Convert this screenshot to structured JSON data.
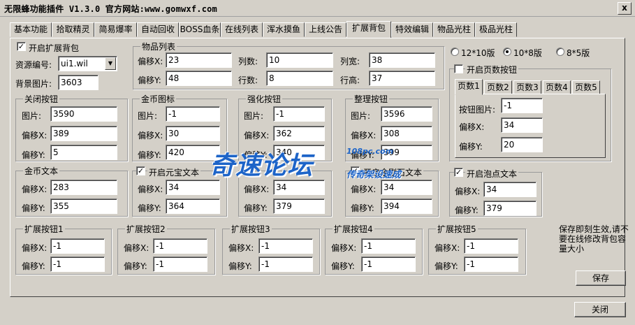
{
  "window": {
    "title": "无限蜂功能插件 V1.3.0  官方网站:www.gomwxf.com",
    "close": "x"
  },
  "tabs": [
    "基本功能",
    "拾取精灵",
    "简易爆率",
    "自动回收",
    "BOSS血条",
    "在线列表",
    "浑水摸鱼",
    "上线公告",
    "扩展背包",
    "特效编辑",
    "物品光柱",
    "极品光柱"
  ],
  "active_tab": "扩展背包",
  "left": {
    "enable_label": "开启扩展背包",
    "enable_checked": true,
    "resource_label": "资源编号:",
    "resource_value": "ui1.wil",
    "bg_label": "背景图片:",
    "bg_value": "3603"
  },
  "item_list": {
    "title": "物品列表",
    "offset_x_label": "偏移X:",
    "offset_x": "23",
    "offset_y_label": "偏移Y:",
    "offset_y": "48",
    "cols_label": "列数:",
    "cols": "10",
    "rows_label": "行数:",
    "rows": "8",
    "col_width_label": "列宽:",
    "col_width": "38",
    "row_height_label": "行高:",
    "row_height": "37"
  },
  "versions": {
    "v1": "12*10版",
    "v2": "10*8版",
    "v3": "8*5版",
    "selected": "10*8版"
  },
  "page_btn": {
    "enable_label": "开启页数按钮",
    "enabled": false,
    "pages": [
      "页数1",
      "页数2",
      "页数3",
      "页数4",
      "页数5"
    ],
    "active_page": "页数1",
    "img_label": "按钮图片:",
    "img": "-1",
    "x_label": "偏移X:",
    "x": "34",
    "y_label": "偏移Y:",
    "y": "20"
  },
  "close_btn_group": {
    "title": "关闭按钮",
    "img_label": "图片:",
    "img": "3590",
    "x_label": "偏移X:",
    "x": "389",
    "y_label": "偏移Y:",
    "y": "5"
  },
  "gold_icon": {
    "title": "金币图标",
    "img_label": "图片:",
    "img": "-1",
    "x_label": "偏移X:",
    "x": "30",
    "y_label": "偏移Y:",
    "y": "420"
  },
  "enhance_btn": {
    "title": "强化按钮",
    "img_label": "图片:",
    "img": "-1",
    "x_label": "偏移X:",
    "x": "362",
    "y_label": "偏移Y:",
    "y": "340"
  },
  "sort_btn": {
    "title": "整理按钮",
    "img_label": "图片:",
    "img": "3596",
    "x_label": "偏移X:",
    "x": "308",
    "y_label": "偏移Y:",
    "y": "399"
  },
  "gold_text": {
    "title": "金币文本",
    "x_label": "偏移X:",
    "x": "283",
    "y_label": "偏移Y:",
    "y": "355"
  },
  "yuanbao_text": {
    "title": "开启元宝文本",
    "checked": true,
    "x_label": "偏移X:",
    "x": "34",
    "y_label": "偏移Y:",
    "y": "364"
  },
  "third_text": {
    "x_label": "偏移X:",
    "x": "34",
    "y_label": "偏移Y:",
    "y": "379"
  },
  "fourth_text": {
    "title": "开启金刚石文本",
    "checked": true,
    "x_label": "偏移X:",
    "x": "34",
    "y_label": "偏移Y:",
    "y": "394"
  },
  "bubble_text": {
    "title": "开启泡点文本",
    "checked": true,
    "x_label": "偏移X:",
    "x": "34",
    "y_label": "偏移Y:",
    "y": "379"
  },
  "ext_btns": [
    {
      "title": "扩展按钮1",
      "x_label": "偏移X:",
      "x": "-1",
      "y_label": "偏移Y:",
      "y": "-1"
    },
    {
      "title": "扩展按钮2",
      "x_label": "偏移X:",
      "x": "-1",
      "y_label": "偏移Y:",
      "y": "-1"
    },
    {
      "title": "扩展按钮3",
      "x_label": "偏移X:",
      "x": "-1",
      "y_label": "偏移Y:",
      "y": "-1"
    },
    {
      "title": "扩展按钮4",
      "x_label": "偏移X:",
      "x": "-1",
      "y_label": "偏移Y:",
      "y": "-1"
    },
    {
      "title": "扩展按钮5",
      "x_label": "偏移X:",
      "x": "-1",
      "y_label": "偏移Y:",
      "y": "-1"
    }
  ],
  "note": "保存即刻生效,请不要在线修改背包容量大小",
  "save": "保存",
  "close": "关闭",
  "watermark": {
    "main": "奇速论坛",
    "site": "108pc.com",
    "slogan": "传奇架设速成"
  }
}
